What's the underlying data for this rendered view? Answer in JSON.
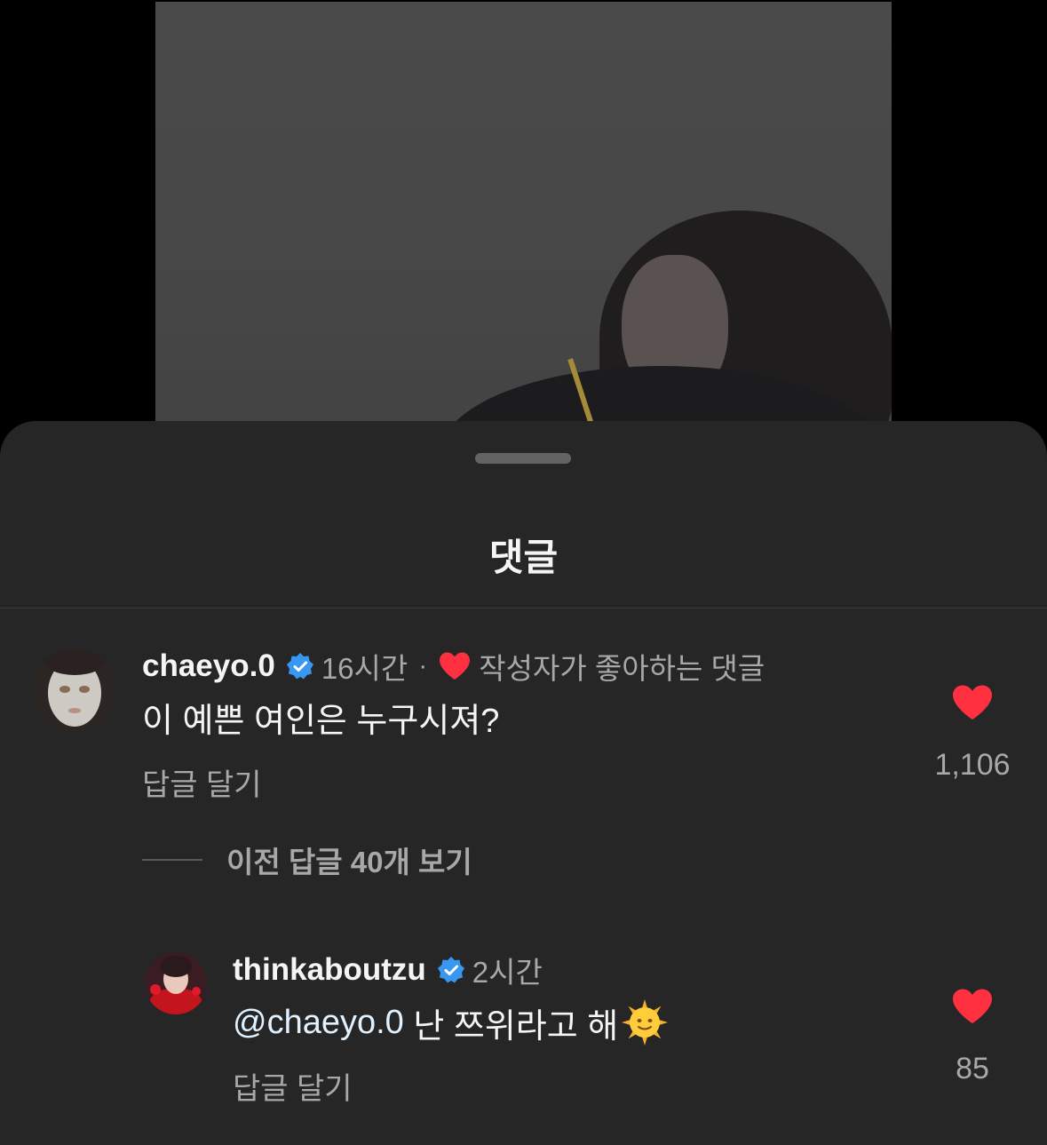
{
  "sheet": {
    "title": "댓글"
  },
  "comments": [
    {
      "username": "chaeyo.0",
      "time": "16시간",
      "separator": "·",
      "author_liked_label": "작성자가 좋아하는 댓글",
      "text": "이 예쁜 여인은 누구시져?",
      "reply_label": "답글 달기",
      "like_count": "1,106"
    }
  ],
  "view_previous_replies": "이전 답글 40개 보기",
  "replies": [
    {
      "username": "thinkaboutzu",
      "time": "2시간",
      "mention": "@chaeyo.0",
      "text": " 난 쯔위라고 해",
      "emoji": "sun-with-face",
      "reply_label": "답글 달기",
      "like_count": "85"
    }
  ],
  "colors": {
    "heart": "#ff3040",
    "verified": "#3897f0",
    "sheet_bg": "#262626",
    "secondary_text": "#a8a8a8"
  }
}
